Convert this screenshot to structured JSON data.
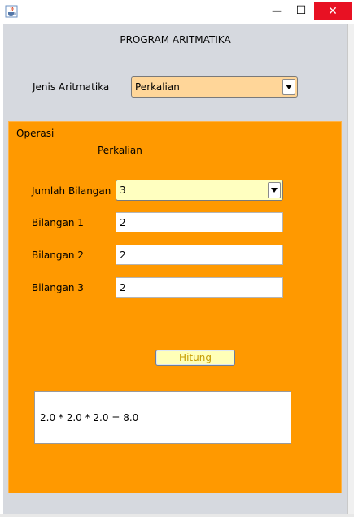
{
  "window": {
    "minimize_glyph": "—",
    "maximize_glyph": "☐",
    "close_glyph": "✕",
    "app_icon": "java-cup-icon"
  },
  "app": {
    "title": "PROGRAM ARITMATIKA",
    "jenis_label": "Jenis Aritmatika",
    "jenis_value": "Perkalian"
  },
  "panel": {
    "title": "Operasi",
    "operation_name": "Perkalian",
    "jumlah_label": "Jumlah Bilangan",
    "jumlah_value": "3",
    "inputs": [
      {
        "label": "Bilangan 1",
        "value": "2"
      },
      {
        "label": "Bilangan 2",
        "value": "2"
      },
      {
        "label": "Bilangan 3",
        "value": "2"
      }
    ],
    "button_label": "Hitung",
    "result": "2.0 * 2.0 * 2.0 = 8.0"
  },
  "colors": {
    "panel_bg": "#ff9900",
    "combo_jenis_bg": "#ffd699",
    "combo_jumlah_bg": "#ffffc0",
    "close_btn": "#e81123"
  }
}
